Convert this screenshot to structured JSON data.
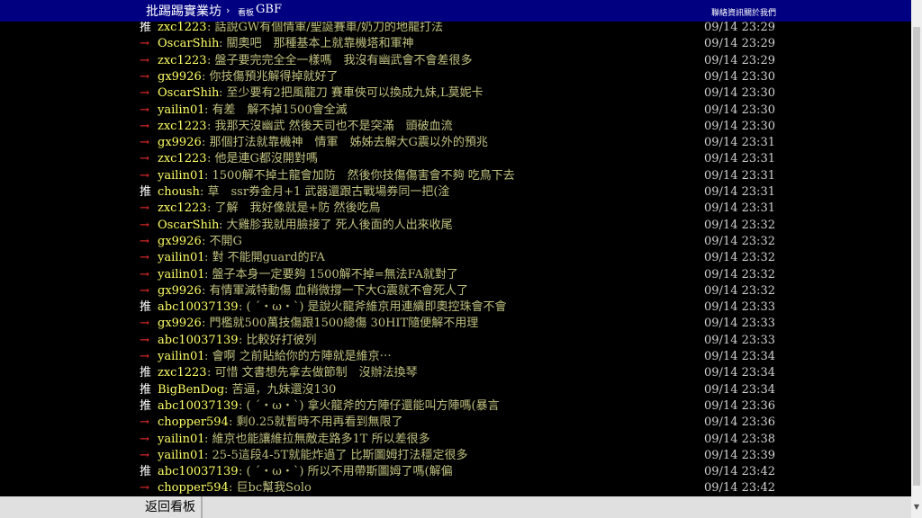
{
  "topbar": {
    "board_title": "批踢踢實業坊",
    "breadcrumb_arrow": "›",
    "board_label": "看板",
    "board_name": "GBF",
    "link_contact": "聯絡資訊",
    "link_about": "關於我們"
  },
  "pushes": [
    {
      "tag": "推",
      "user": "zxc1223",
      "text": ": 話說GW有個情軍/聖誕賽車/奶刀的地龍打法",
      "time": "09/14 23:29"
    },
    {
      "tag": "→",
      "user": "OscarShih",
      "text": ": 關奧吧　那種基本上就靠機塔和軍神",
      "time": "09/14 23:29"
    },
    {
      "tag": "→",
      "user": "zxc1223",
      "text": ": 盤子要完完全全一樣嗎　我沒有幽武會不會差很多",
      "time": "09/14 23:29"
    },
    {
      "tag": "→",
      "user": "gx9926",
      "text": ": 你技傷預兆解得掉就好了",
      "time": "09/14 23:30"
    },
    {
      "tag": "→",
      "user": "OscarShih",
      "text": ": 至少要有2把風龍刀 賽車俠可以換成九妹,L莫妮卡",
      "time": "09/14 23:30"
    },
    {
      "tag": "→",
      "user": "yailin01",
      "text": ": 有差　解不掉1500會全滅",
      "time": "09/14 23:30"
    },
    {
      "tag": "→",
      "user": "zxc1223",
      "text": ": 我那天沒幽武 然後天司也不是突滿　頭破血流",
      "time": "09/14 23:30"
    },
    {
      "tag": "→",
      "user": "gx9926",
      "text": ": 那個打法就靠機神　情軍　姊姊去解大G震以外的預兆",
      "time": "09/14 23:31"
    },
    {
      "tag": "→",
      "user": "zxc1223",
      "text": ": 他是連G都沒開對嗎",
      "time": "09/14 23:31"
    },
    {
      "tag": "→",
      "user": "yailin01",
      "text": ": 1500解不掉土龍會加防　然後你技傷傷害會不夠 吃鳥下去",
      "time": "09/14 23:31"
    },
    {
      "tag": "推",
      "user": "choush",
      "text": ": 草　ssr券金月+1 武器還跟古戰場券同一把(淦",
      "time": "09/14 23:31"
    },
    {
      "tag": "→",
      "user": "zxc1223",
      "text": ": 了解　我好像就是+防 然後吃鳥",
      "time": "09/14 23:31"
    },
    {
      "tag": "→",
      "user": "OscarShih",
      "text": ": 大雞胗我就用臉接了 死人後面的人出來收尾",
      "time": "09/14 23:32"
    },
    {
      "tag": "→",
      "user": "gx9926",
      "text": ": 不開G",
      "time": "09/14 23:32"
    },
    {
      "tag": "→",
      "user": "yailin01",
      "text": ": 對 不能開guard的FA",
      "time": "09/14 23:32"
    },
    {
      "tag": "→",
      "user": "yailin01",
      "text": ": 盤子本身一定要夠 1500解不掉=無法FA就對了",
      "time": "09/14 23:32"
    },
    {
      "tag": "→",
      "user": "gx9926",
      "text": ": 有情軍減特動傷 血稍微撐一下大G震就不會死人了",
      "time": "09/14 23:32"
    },
    {
      "tag": "推",
      "user": "abc10037139",
      "text": ": ( ´・ω・`) 是說火龍斧維京用連續即奧控珠會不會",
      "time": "09/14 23:33"
    },
    {
      "tag": "→",
      "user": "gx9926",
      "text": ": 門檻就500萬技傷跟1500總傷 30HIT隨便解不用理",
      "time": "09/14 23:33"
    },
    {
      "tag": "→",
      "user": "abc10037139",
      "text": ": 比較好打彼列",
      "time": "09/14 23:33"
    },
    {
      "tag": "→",
      "user": "yailin01",
      "text": ": 會啊 之前貼給你的方陣就是維京⋯",
      "time": "09/14 23:34"
    },
    {
      "tag": "推",
      "user": "zxc1223",
      "text": ": 可惜 文書想先拿去做節制　沒辦法換琴",
      "time": "09/14 23:34"
    },
    {
      "tag": "推",
      "user": "BigBenDog",
      "text": ": 苦逼，九妹還沒130",
      "time": "09/14 23:34"
    },
    {
      "tag": "推",
      "user": "abc10037139",
      "text": ": ( ´・ω・`) 拿火龍斧的方陣仔還能叫方陣嗎(暴言",
      "time": "09/14 23:36"
    },
    {
      "tag": "→",
      "user": "chopper594",
      "text": ": 剩0.25就暫時不用再看到無限了",
      "time": "09/14 23:36"
    },
    {
      "tag": "→",
      "user": "yailin01",
      "text": ": 維京也能讓維拉無敵走路多1T 所以差很多",
      "time": "09/14 23:38"
    },
    {
      "tag": "→",
      "user": "yailin01",
      "text": ": 25-5這段4-5T就能炸過了 比斯圖姆打法穩定很多",
      "time": "09/14 23:39"
    },
    {
      "tag": "推",
      "user": "abc10037139",
      "text": ": ( ´・ω・`) 所以不用帶斯圖姆了嗎(解偏",
      "time": "09/14 23:42"
    },
    {
      "tag": "→",
      "user": "chopper594",
      "text": ": 巨bc幫我Solo",
      "time": "09/14 23:42"
    }
  ],
  "bottombar": {
    "back_label": "返回看板"
  },
  "colors": {
    "topbar_bg": "#000080",
    "push_tag": "#ffffff",
    "arrow_tag": "#ff3030",
    "userid": "#ffff66",
    "content": "#c0c080",
    "time": "#d0d0d0"
  }
}
